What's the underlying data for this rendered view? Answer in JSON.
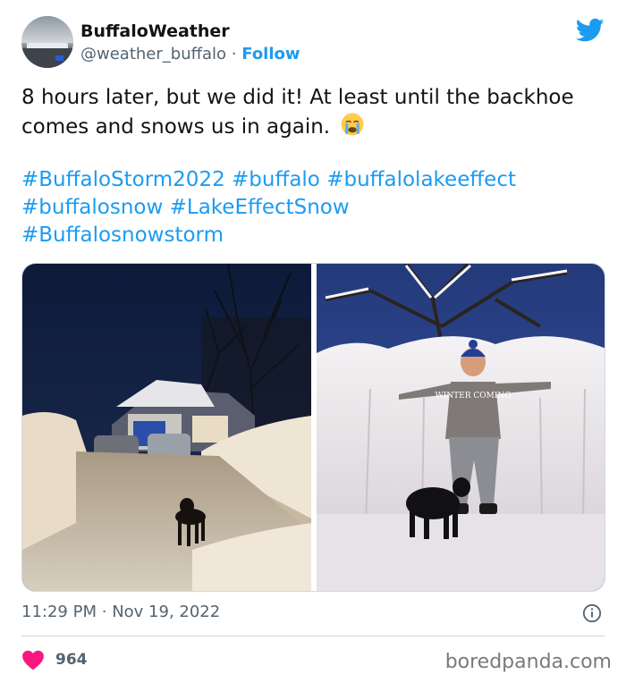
{
  "user": {
    "display_name": "BuffaloWeather",
    "handle": "@weather_buffalo",
    "separator": "·",
    "follow_label": "Follow"
  },
  "tweet": {
    "text": "8 hours later, but we did it! At least until the backhoe comes and snows us in again.",
    "emoji": "crying-face-emoji",
    "hashtags": [
      "#BuffaloStorm2022",
      "#buffalo",
      "#buffalolakeeffect",
      "#buffalosnow",
      "#LakeEffectSnow",
      "#Buffalosnowstorm"
    ],
    "time": "11:29 PM",
    "date_separator": "·",
    "date": "Nov 19, 2022",
    "like_count": "964"
  },
  "media": {
    "photo_right_shirt_text": "WINTER COMING"
  },
  "watermark": "boredpanda.com",
  "icons": {
    "platform": "twitter-bird-icon",
    "info": "info-icon",
    "like": "heart-icon"
  },
  "colors": {
    "accent": "#1d9bf0",
    "like": "#f91880",
    "secondary_text": "#536471"
  }
}
